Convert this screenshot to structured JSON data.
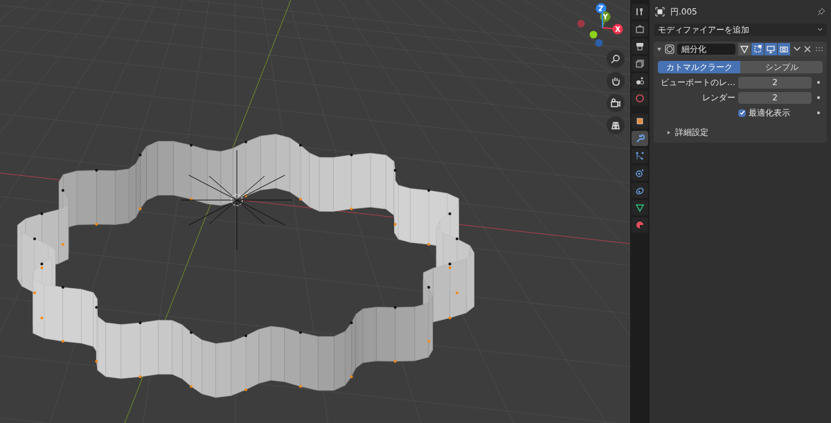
{
  "viewport": {
    "gizmo_axes": [
      {
        "label": "Z",
        "color": "#2f86f0"
      },
      {
        "label": "Y",
        "color": "#6a9a1e"
      },
      {
        "label": "X",
        "color": "#f0334f"
      }
    ]
  },
  "properties": {
    "tabs": [
      {
        "kind": "tool",
        "selected": false
      },
      {
        "kind": "render",
        "selected": false
      },
      {
        "kind": "output",
        "selected": false
      },
      {
        "kind": "view_layer",
        "selected": false
      },
      {
        "kind": "scene",
        "selected": false
      },
      {
        "kind": "world",
        "selected": false
      },
      {
        "kind": "object",
        "selected": false
      },
      {
        "kind": "modifier",
        "selected": true
      },
      {
        "kind": "particles",
        "selected": false
      },
      {
        "kind": "physics",
        "selected": false
      },
      {
        "kind": "constraints",
        "selected": false
      },
      {
        "kind": "data",
        "selected": false
      },
      {
        "kind": "material",
        "selected": false
      }
    ],
    "object_name": "円.005",
    "add_modifier": "モディファイアーを追加",
    "modifier": {
      "expanded": true,
      "name": "細分化",
      "toggles": [
        {
          "kind": "cage",
          "on": false
        },
        {
          "kind": "editmode",
          "on": true
        },
        {
          "kind": "viewport",
          "on": true
        },
        {
          "kind": "render",
          "on": true
        }
      ],
      "types": [
        {
          "label": "カトマルクラーク",
          "selected": true
        },
        {
          "label": "シンプル",
          "selected": false
        }
      ],
      "fields": [
        {
          "label": "ビューポートのレ…",
          "value": "2"
        },
        {
          "label": "レンダー",
          "value": "2"
        }
      ],
      "checkbox": {
        "label": "最適化表示",
        "checked": true
      },
      "subpanel": {
        "label": "詳細設定",
        "expanded": false
      }
    }
  }
}
